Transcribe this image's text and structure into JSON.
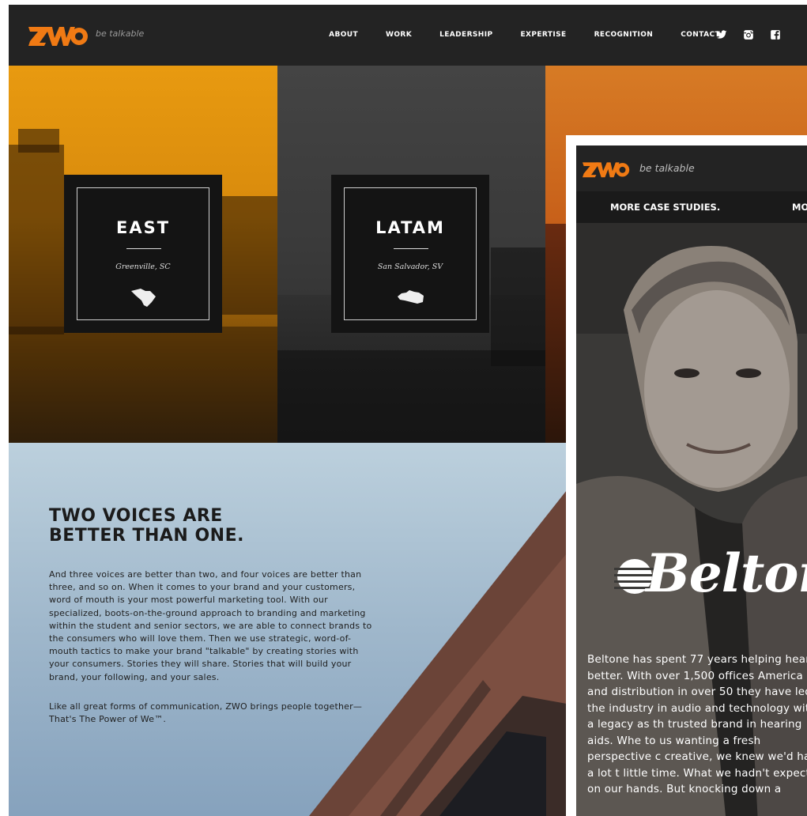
{
  "header": {
    "brand": "ZWO",
    "tagline": "be talkable",
    "nav": [
      "ABOUT",
      "WORK",
      "LEADERSHIP",
      "EXPERTISE",
      "RECOGNITION",
      "CONTACT"
    ],
    "social": [
      "twitter-icon",
      "instagram-icon",
      "facebook-icon"
    ]
  },
  "locations": [
    {
      "title": "EAST",
      "city": "Greenville, SC",
      "icon": "south-carolina-map-icon"
    },
    {
      "title": "LATAM",
      "city": "San Salvador, SV",
      "icon": "el-salvador-map-icon"
    }
  ],
  "about": {
    "heading_line1": "TWO VOICES ARE",
    "heading_line2": "BETTER THAN ONE.",
    "paragraph1": "And three voices are better than two, and four voices are better than three, and so on. When it comes to your brand and your customers, word of mouth is your most powerful marketing tool. With our specialized, boots-on-the-ground approach to branding and marketing within the student and senior sectors, we are able to connect brands to the consumers who will love them. Then we use strategic, word-of-mouth tactics to make your brand \"talkable\" by creating stories with your consumers. Stories they will share. Stories that will build your brand, your following, and your sales.",
    "paragraph2": "Like all great forms of communication, ZWO brings people together—That's The Power of We™."
  },
  "case_study": {
    "brand": "ZWO",
    "tagline": "be talkable",
    "bar_left": "MORE CASE STUDIES.",
    "bar_right": "MO",
    "client": "Belton",
    "description": "Beltone has spent 77 years helping hear better. With over 1,500 offices America and distribution in over 50 they have led the industry in audio and technology with a legacy as th trusted brand in hearing aids. Whe to us wanting a fresh perspective c creative, we knew we'd have a lot t little time. What we hadn't expecte on our hands. But knocking down a"
  },
  "colors": {
    "accent": "#f07a14",
    "dark": "#232323",
    "text": "#1b1b1b"
  }
}
